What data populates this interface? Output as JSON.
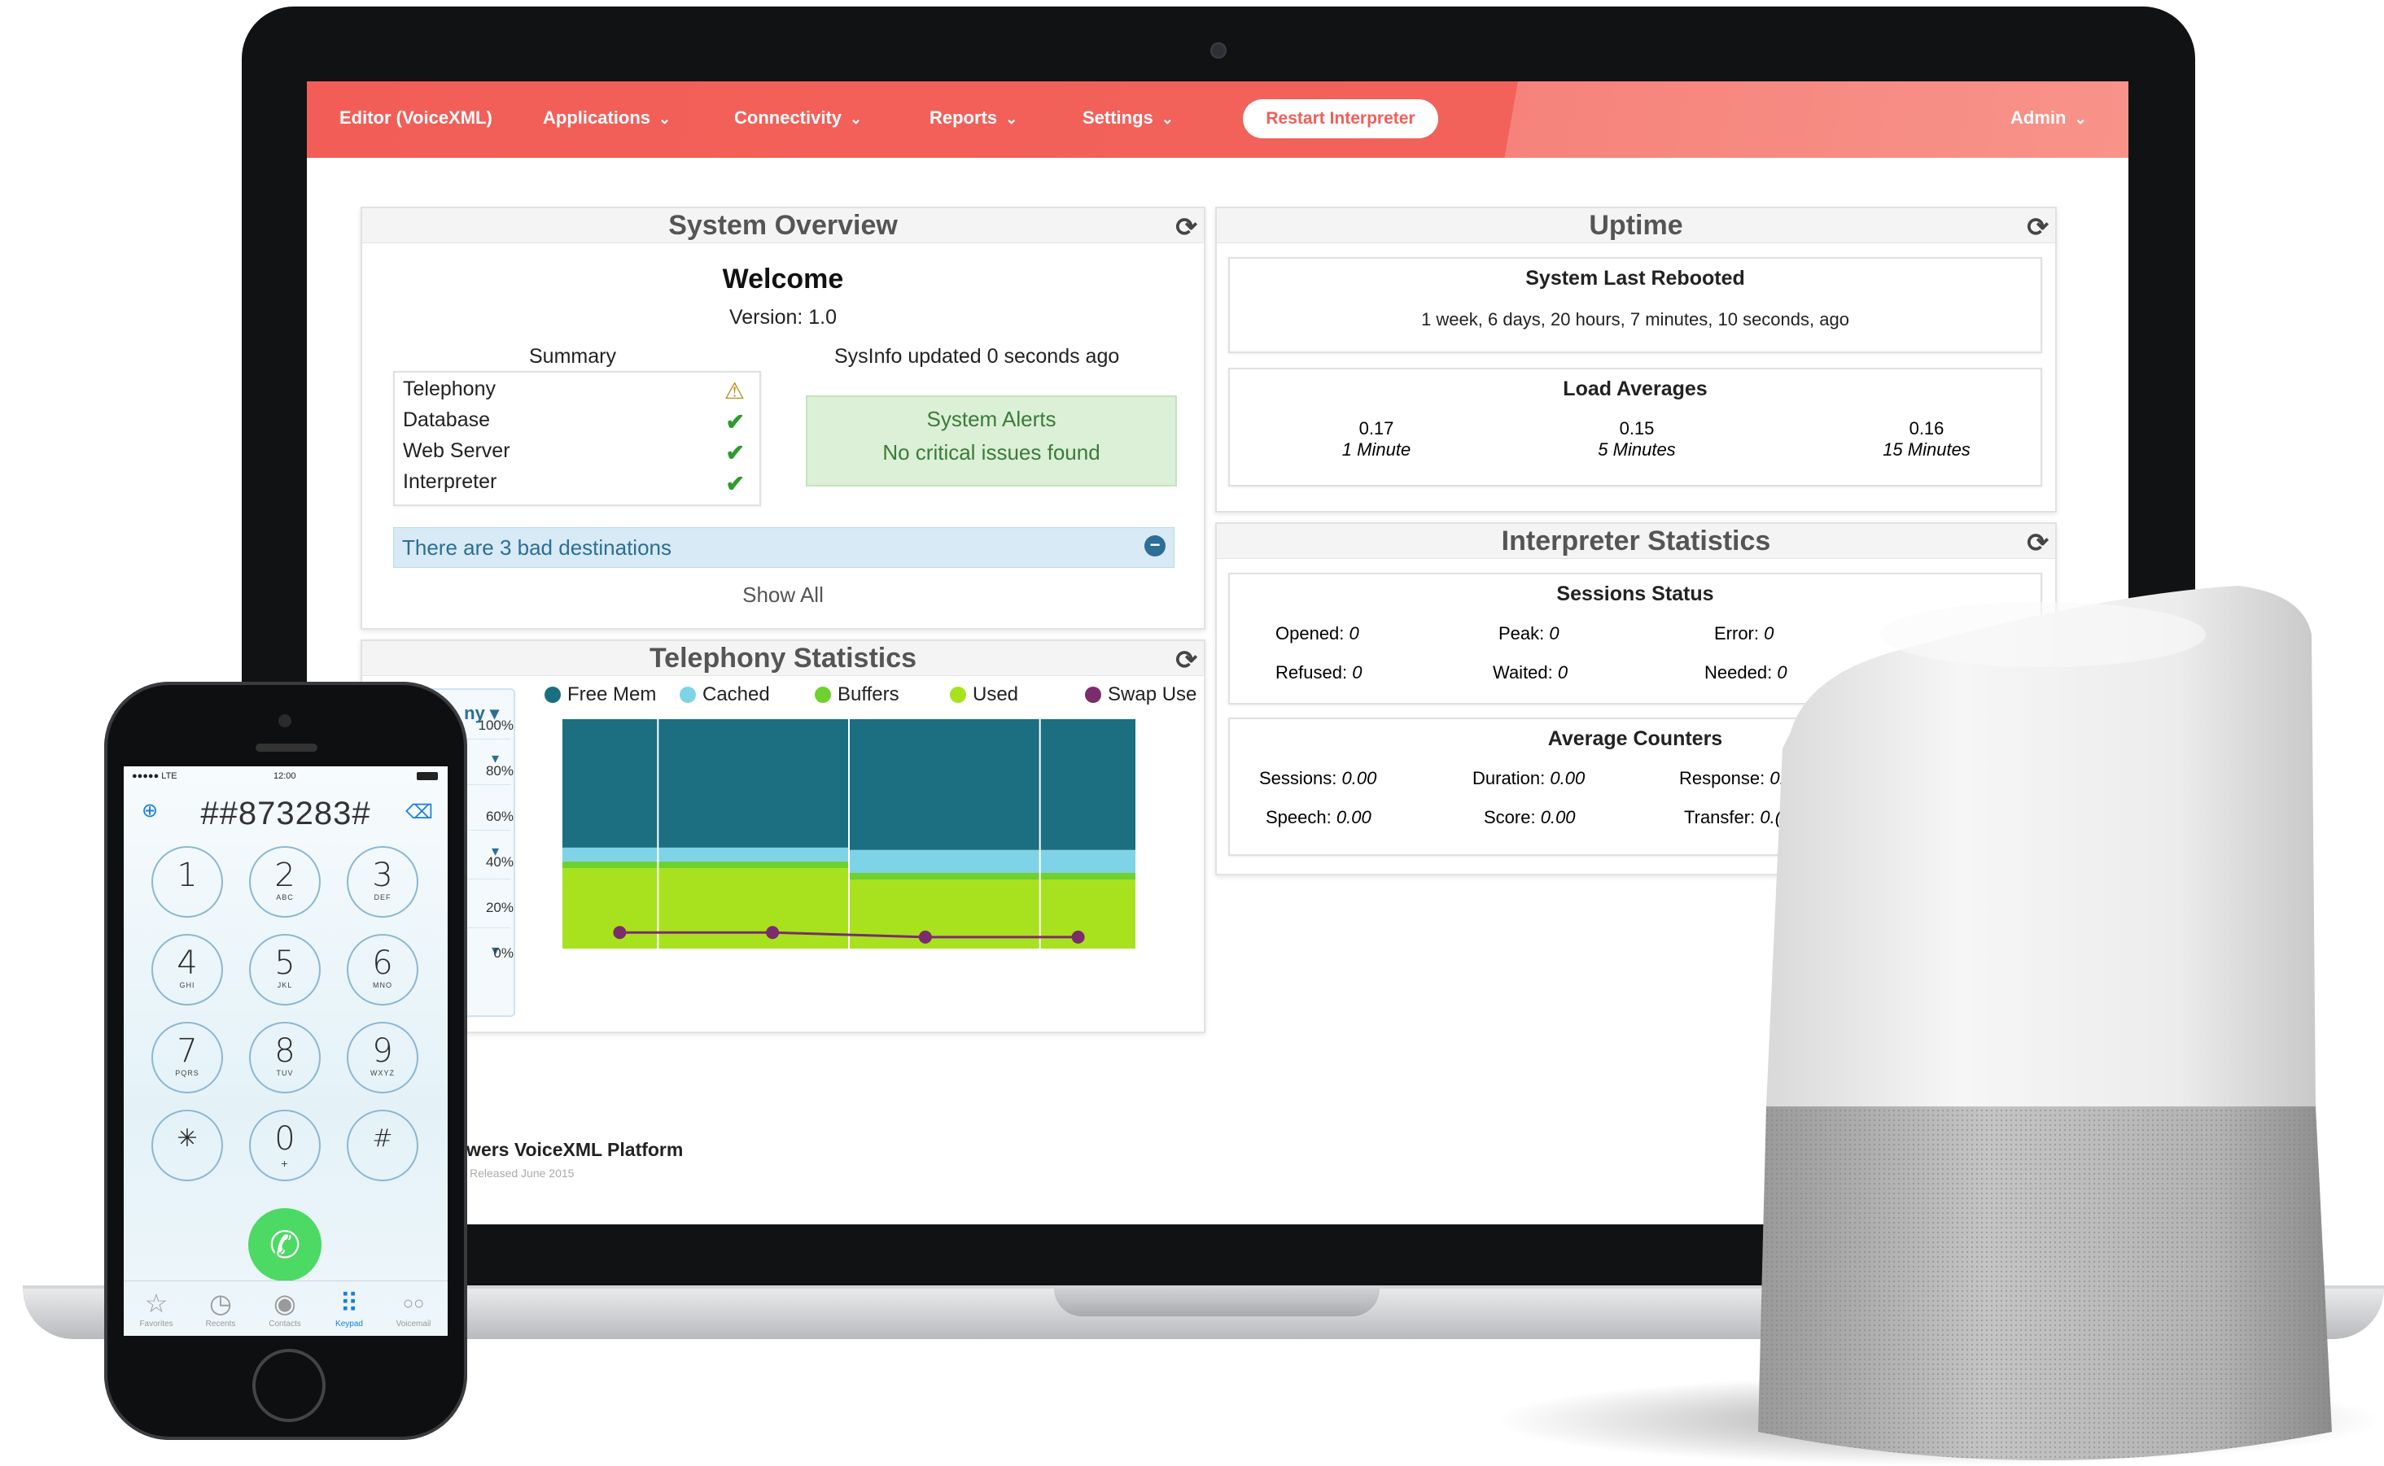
{
  "navbar": {
    "items": [
      {
        "label": "Editor (VoiceXML)",
        "caret": false
      },
      {
        "label": "Applications",
        "caret": true
      },
      {
        "label": "Connectivity",
        "caret": true
      },
      {
        "label": "Reports",
        "caret": true
      },
      {
        "label": "Settings",
        "caret": true
      }
    ],
    "restart_label": "Restart Interpreter",
    "admin_label": "Admin",
    "color": "#f25e57"
  },
  "system_overview": {
    "title": "System Overview",
    "welcome": "Welcome",
    "version": "Version: 1.0",
    "summary_title": "Summary",
    "summary": [
      {
        "name": "Telephony",
        "status": "warning"
      },
      {
        "name": "Database",
        "status": "ok"
      },
      {
        "name": "Web Server",
        "status": "ok"
      },
      {
        "name": "Interpreter",
        "status": "ok"
      }
    ],
    "sysinfo": "SysInfo updated 0 seconds ago",
    "alerts_title": "System Alerts",
    "alerts_text": "No critical issues found",
    "bad_destinations": "There are 3 bad destinations",
    "show_all": "Show All"
  },
  "telephony_statistics": {
    "title": "Telephony Statistics",
    "visible_select_fragments": [
      "ny",
      "",
      "",
      "",
      "",
      ""
    ]
  },
  "chart_data": {
    "type": "area",
    "title": "",
    "legend": [
      "Free Mem",
      "Cached",
      "Buffers",
      "Used",
      "Swap Use"
    ],
    "legend_colors": [
      "#1b6f80",
      "#7fd3e6",
      "#6fd12d",
      "#a8e21f",
      "#7b2d6b"
    ],
    "y_ticks": [
      "100%",
      "80%",
      "60%",
      "40%",
      "20%",
      "0%"
    ],
    "ylim": [
      0,
      100
    ],
    "x": [
      1,
      2,
      3,
      4
    ],
    "series": [
      {
        "name": "Used",
        "values": [
          35,
          35,
          30,
          30
        ]
      },
      {
        "name": "Buffers",
        "values": [
          3,
          3,
          3,
          3
        ]
      },
      {
        "name": "Cached",
        "values": [
          6,
          6,
          10,
          10
        ]
      },
      {
        "name": "Free Mem",
        "values": [
          56,
          56,
          57,
          57
        ]
      },
      {
        "name": "Swap Use",
        "values": [
          7,
          7,
          5,
          5
        ]
      }
    ]
  },
  "uptime": {
    "title": "Uptime",
    "last_rebooted_title": "System Last Rebooted",
    "last_rebooted_value": "1 week, 6 days, 20 hours, 7 minutes, 10 seconds, ago",
    "load_title": "Load Averages",
    "loads": [
      {
        "value": "0.17",
        "label": "1 Minute"
      },
      {
        "value": "0.15",
        "label": "5 Minutes"
      },
      {
        "value": "0.16",
        "label": "15 Minutes"
      }
    ]
  },
  "interpreter_statistics": {
    "title": "Interpreter Statistics",
    "sessions_title": "Sessions Status",
    "sessions": [
      {
        "label": "Opened:",
        "value": "0"
      },
      {
        "label": "Peak:",
        "value": "0"
      },
      {
        "label": "Error:",
        "value": "0"
      },
      {
        "label": "Refused:",
        "value": "0"
      },
      {
        "label": "Waited:",
        "value": "0"
      },
      {
        "label": "Needed:",
        "value": "0"
      }
    ],
    "counters_title": "Average Counters",
    "counters": [
      {
        "label": "Sessions:",
        "value": "0.00"
      },
      {
        "label": "Duration:",
        "value": "0.00"
      },
      {
        "label": "Response:",
        "value": "0."
      },
      {
        "label": "Speech:",
        "value": "0.00"
      },
      {
        "label": "Score:",
        "value": "0.00"
      },
      {
        "label": "Transfer:",
        "value": "0.("
      }
    ]
  },
  "footer": {
    "product": "owers VoiceXML Platform",
    "released": "Released June 2015"
  },
  "phone": {
    "carrier": "●●●●● LTE",
    "time": "12:00",
    "dialed": "##873283#",
    "keys": [
      {
        "d": "1",
        "l": ""
      },
      {
        "d": "2",
        "l": "ABC"
      },
      {
        "d": "3",
        "l": "DEF"
      },
      {
        "d": "4",
        "l": "GHI"
      },
      {
        "d": "5",
        "l": "JKL"
      },
      {
        "d": "6",
        "l": "MNO"
      },
      {
        "d": "7",
        "l": "PQRS"
      },
      {
        "d": "8",
        "l": "TUV"
      },
      {
        "d": "9",
        "l": "WXYZ"
      },
      {
        "d": "✳",
        "l": ""
      },
      {
        "d": "0",
        "l": "+"
      },
      {
        "d": "#",
        "l": ""
      }
    ],
    "tabs": [
      {
        "icon": "☆",
        "label": "Favorites"
      },
      {
        "icon": "◷",
        "label": "Recents"
      },
      {
        "icon": "◉",
        "label": "Contacts"
      },
      {
        "icon": "⠿",
        "label": "Keypad"
      },
      {
        "icon": "○○",
        "label": "Voicemail"
      }
    ],
    "active_tab_color": "#1a7fe0"
  }
}
